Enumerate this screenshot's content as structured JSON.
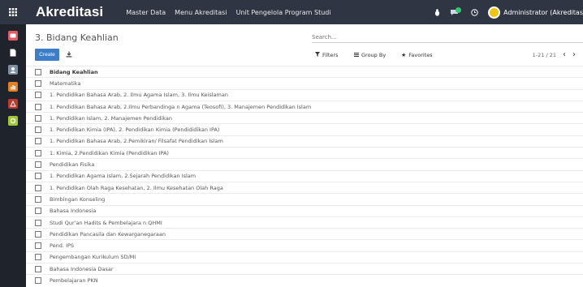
{
  "navbar": {
    "brand": "Akreditasi",
    "menus": [
      "Master Data",
      "Menu Akreditasi",
      "Unit Pengelola Program Studi"
    ],
    "user": "Administrator (Akreditas"
  },
  "sidebar": {
    "icons": [
      {
        "name": "discuss-app-icon",
        "color": "#e05a6a"
      },
      {
        "name": "documents-app-icon",
        "color": "#ffffff"
      },
      {
        "name": "contacts-app-icon",
        "color": "#7f8fa6"
      },
      {
        "name": "reports-app-icon",
        "color": "#e67e22"
      },
      {
        "name": "accreditation-app-icon",
        "color": "#c0392b"
      },
      {
        "name": "settings-app-icon",
        "color": "#a4c639"
      }
    ]
  },
  "control_panel": {
    "breadcrumb": "3. Bidang Keahlian",
    "search_placeholder": "Search...",
    "create_label": "Create",
    "filters_label": "Filters",
    "group_by_label": "Group By",
    "favorites_label": "Favorites",
    "pager": "1-21 / 21"
  },
  "list": {
    "header": "Bidang Keahlian",
    "rows": [
      "Matematika",
      "1. Pendidikan Bahasa Arab, 2. Ilmu Agama Islam, 3. Ilmu Keislaman",
      "1. Pendidikan Bahasa Arab, 2.Ilmu Perbandinga n Agama (Teosofi), 3. Manajemen Pendidikan Islam",
      "1. Pendidikan Islam, 2. Manajemen Pendidikan",
      "1. Pendidikan Kimia (IPA), 2. Pendidikan Kimia (Pendididikan IPA)",
      "1. Pendidikan Bahasa Arab, 2.Pemikiran/ Filsafat Pendidikan Islam",
      "1. Kimia, 2.Pendidikan Kimia (Pendidikan IPA)",
      "Pendidikan Fisika",
      "1. Pendidikan Agama Islam, 2.Sejarah Pendidikan Islam",
      "1. Pendidikan Olah Raga Kesehatan, 2. Ilmu Kesehatan Olah Raga",
      "Bimbingan Konseling",
      "Bahasa Indonesia",
      "Studi Qur'an Hadits & Pembelajara n QHMI",
      "Pendidikan Pancasila dan Kewarganegaraan",
      "Pend. IPS",
      "Pengembangan Kurikulum SD/MI",
      "Bahasa Indonesia Dasar",
      "Pembelajaran PKN"
    ]
  }
}
